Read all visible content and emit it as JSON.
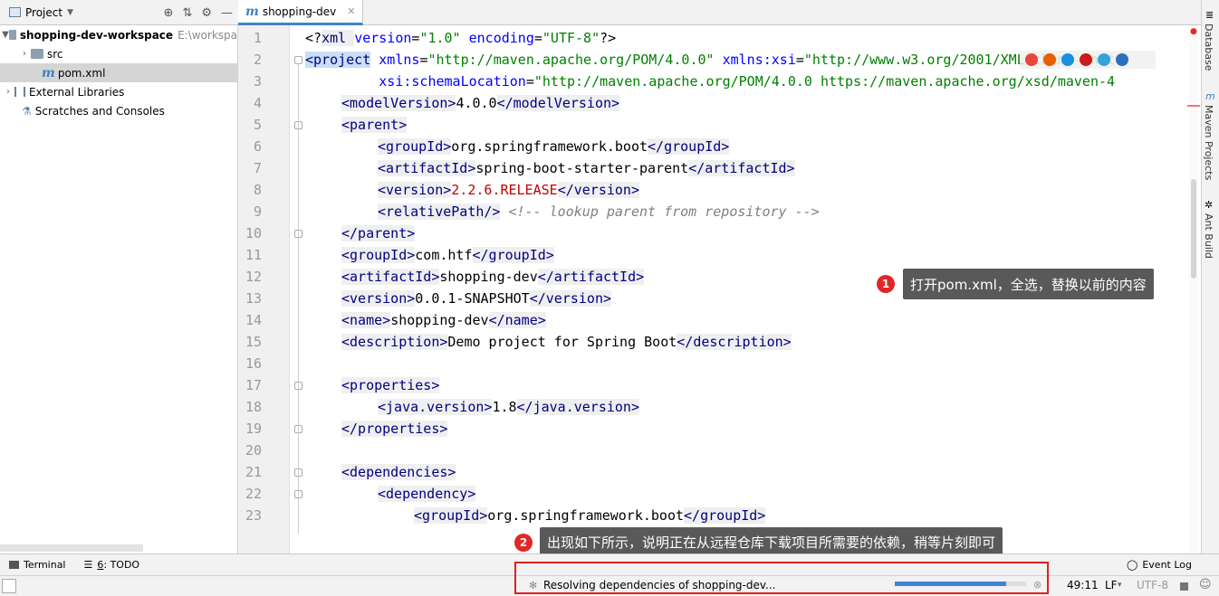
{
  "project": {
    "title": "Project",
    "tree": [
      {
        "label": "shopping-dev-workspace",
        "path": "E:\\workspa"
      },
      {
        "label": "src"
      },
      {
        "label": "pom.xml"
      },
      {
        "label": "External Libraries"
      },
      {
        "label": "Scratches and Consoles"
      }
    ]
  },
  "editor": {
    "tab_label": "shopping-dev",
    "line_numbers": [
      "1",
      "2",
      "3",
      "4",
      "5",
      "6",
      "7",
      "8",
      "9",
      "10",
      "11",
      "12",
      "13",
      "14",
      "15",
      "16",
      "17",
      "18",
      "19",
      "20",
      "21",
      "22",
      "23"
    ],
    "lines": {
      "l1": {
        "a": "<?",
        "b": "xml ",
        "c": "version",
        "d": "=",
        "e": "\"1.0\"",
        "f": " ",
        "g": "encoding",
        "h": "=",
        "i": "\"UTF-8\"",
        "j": "?>"
      },
      "l2": {
        "a": "<project",
        "b": " ",
        "c": "xmlns",
        "d": "=",
        "e": "\"http://maven.apache.org/POM/4.0.0\"",
        "f": " ",
        "g": "xmlns:xsi",
        "h": "=",
        "i": "\"http://www.w3.org/2001/XMLSchema-inst"
      },
      "l3": {
        "a": "         ",
        "b": "xsi:schemaLocation",
        "c": "=",
        "d": "\"http://maven.apache.org/POM/4.0.0 https://maven.apache.org/xsd/maven-4"
      },
      "l4": {
        "a": "<modelVersion>",
        "b": "4.0.0",
        "c": "</modelVersion>"
      },
      "l5": {
        "a": "<parent>"
      },
      "l6": {
        "a": "<groupId>",
        "b": "org.springframework.boot",
        "c": "</groupId>"
      },
      "l7": {
        "a": "<artifactId>",
        "b": "spring-boot-starter-parent",
        "c": "</artifactId>"
      },
      "l8": {
        "a": "<version>",
        "b": "2.2.6.RELEASE",
        "c": "</version>"
      },
      "l9": {
        "a": "<relativePath/>",
        "b": " ",
        "c": "<!-- lookup parent from repository -->"
      },
      "l10": {
        "a": "</parent>"
      },
      "l11": {
        "a": "<groupId>",
        "b": "com.htf",
        "c": "</groupId>"
      },
      "l12": {
        "a": "<artifactId>",
        "b": "shopping-dev",
        "c": "</artifactId>"
      },
      "l13": {
        "a": "<version>",
        "b": "0.0.1-SNAPSHOT",
        "c": "</version>"
      },
      "l14": {
        "a": "<name>",
        "b": "shopping-dev",
        "c": "</name>"
      },
      "l15": {
        "a": "<description>",
        "b": "Demo project for Spring Boot",
        "c": "</description>"
      },
      "l17": {
        "a": "<properties>"
      },
      "l18": {
        "a": "<java.version>",
        "b": "1.8",
        "c": "</java.version>"
      },
      "l19": {
        "a": "</properties>"
      },
      "l21": {
        "a": "<dependencies>"
      },
      "l22": {
        "a": "<dependency>"
      },
      "l23": {
        "a": "<groupId>",
        "b": "org.springframework.boot",
        "c": "</groupId>"
      }
    }
  },
  "right_tools": [
    "Database",
    "Maven Projects",
    "Ant Build"
  ],
  "annotations": {
    "one": {
      "num": "1",
      "text": "打开pom.xml，全选，替换以前的内容"
    },
    "two": {
      "num": "2",
      "text": "出现如下所示，说明正在从远程仓库下载项目所需要的依赖，稍等片刻即可"
    }
  },
  "toolbar": {
    "terminal": "Terminal",
    "todo_num": "6",
    "todo": ": TODO",
    "event_log": "Event Log"
  },
  "status": {
    "message": "Resolving dependencies of shopping-dev...",
    "progress": 0.85,
    "position": "49:11",
    "line_sep": "LF",
    "encoding": "UTF-8"
  },
  "colors": {
    "accent": "#4083c9",
    "annotation_badge": "#e22626",
    "highlight_box": "#e02020"
  }
}
